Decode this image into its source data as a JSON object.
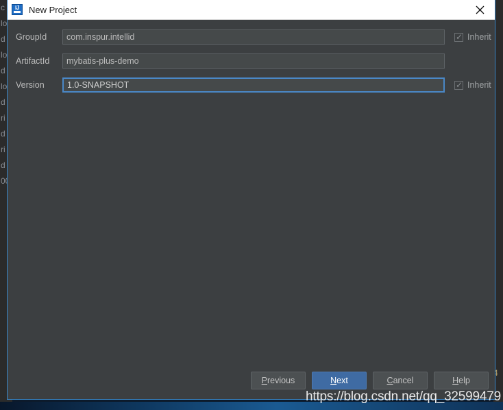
{
  "window": {
    "title": "New Project",
    "icon_name": "intellij-idea-icon",
    "icon_text": "IJ",
    "close_icon": "close-icon"
  },
  "form": {
    "rows": [
      {
        "label": "GroupId",
        "value": "com.inspur.intellid",
        "focused": false,
        "inherit": {
          "label": "Inherit",
          "checked": true
        }
      },
      {
        "label": "ArtifactId",
        "value": "mybatis-plus-demo",
        "focused": false,
        "inherit": null
      },
      {
        "label": "Version",
        "value": "1.0-SNAPSHOT",
        "focused": true,
        "inherit": {
          "label": "Inherit",
          "checked": true
        }
      }
    ],
    "checkbox_tick": "✓"
  },
  "buttons": {
    "previous": {
      "label": "Previous",
      "mnemonic": "P",
      "rest": "revious"
    },
    "next": {
      "label": "Next",
      "mnemonic": "N",
      "rest": "ext"
    },
    "cancel": {
      "label": "Cancel",
      "mnemonic": "C",
      "rest": "ancel"
    },
    "help": {
      "label": "Help",
      "mnemonic": "H",
      "rest": "elp"
    }
  },
  "watermark": {
    "text": "https://blog.csdn.net/qq_32599479"
  },
  "backdrop": {
    "left_fragments": [
      "c",
      "lo",
      "d",
      "lo",
      "d",
      "lo",
      "d",
      "ri",
      "d",
      "ri",
      "d",
      "00"
    ],
    "right_fragments": [
      "4"
    ]
  },
  "colors": {
    "dialog_background": "#3c3f41",
    "dialog_border": "#3a87c8",
    "titlebar_background": "#ffffff",
    "field_background": "#45494a",
    "field_border": "#5e6366",
    "focus_border": "#4a88c7",
    "default_button": "#3f6ba3",
    "button_background": "#4c5052",
    "label_text": "#bbbbbb",
    "accent": "#1f6dc4"
  }
}
